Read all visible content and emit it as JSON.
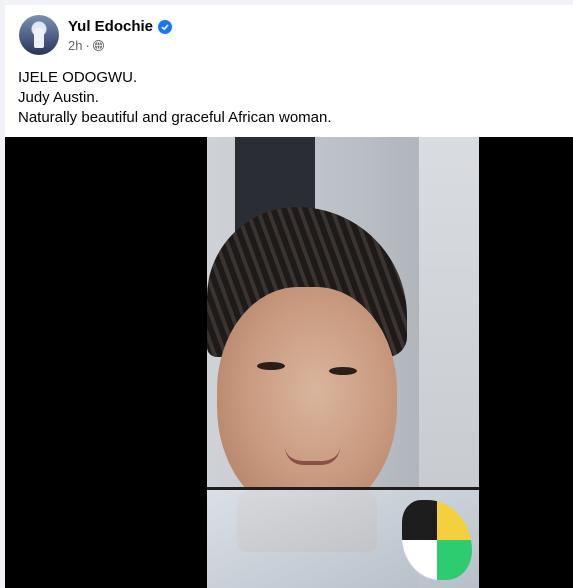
{
  "post": {
    "author_name": "Yul Edochie",
    "time": "2h",
    "separator": "·",
    "caption_lines": [
      "IJELE ODOGWU.",
      "Judy Austin.",
      "Naturally beautiful and graceful African woman."
    ]
  },
  "colors": {
    "verified_badge": "#1877f2",
    "meta_text": "#65676b"
  },
  "icons": {
    "verified": "verified-badge-icon",
    "audience": "globe-icon"
  }
}
